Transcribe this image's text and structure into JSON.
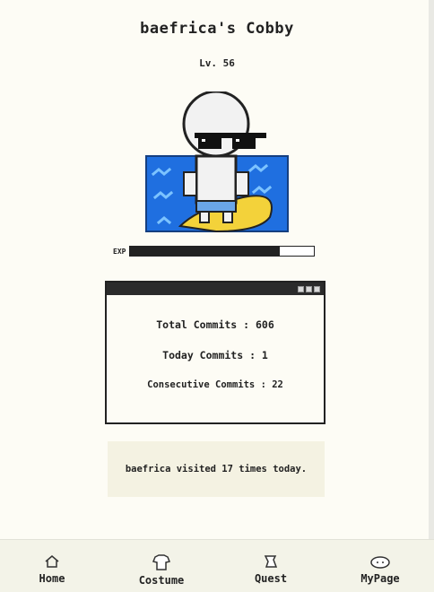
{
  "header": {
    "title": "baefrica's Cobby",
    "level": "Lv. 56"
  },
  "character": {
    "costume": "sunglasses",
    "background": "pool"
  },
  "exp": {
    "label": "EXP",
    "progress": 0.81
  },
  "stats_window": {
    "total_commits": "Total Commits : 606",
    "today_commits": "Today Commits : 1",
    "consecutive_commits": "Consecutive Commits : 22"
  },
  "visit_message": "baefrica visited 17 times today.",
  "nav": {
    "items": [
      {
        "label": "Home",
        "icon": "house-icon"
      },
      {
        "label": "Costume",
        "icon": "shirt-icon"
      },
      {
        "label": "Quest",
        "icon": "scroll-icon"
      },
      {
        "label": "MyPage",
        "icon": "face-icon"
      }
    ]
  },
  "colors": {
    "background": "#fdfcf5",
    "pool_blue": "#1f6fe0",
    "float_yellow": "#f3d23a",
    "dark": "#222222"
  }
}
